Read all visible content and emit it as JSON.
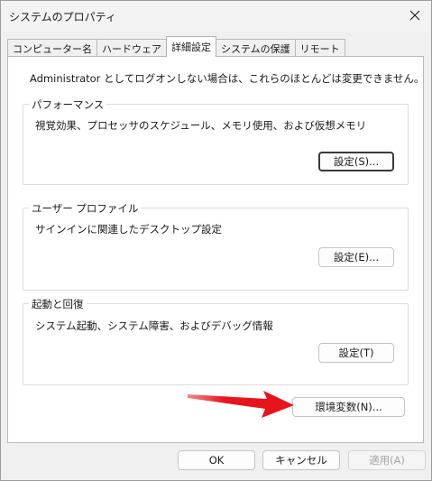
{
  "window": {
    "title": "システムのプロパティ",
    "close_glyph": "✕"
  },
  "tabs": [
    {
      "label": "コンピューター名"
    },
    {
      "label": "ハードウェア"
    },
    {
      "label": "詳細設定",
      "active": true
    },
    {
      "label": "システムの保護"
    },
    {
      "label": "リモート"
    }
  ],
  "panel": {
    "intro": "Administrator としてログオンしない場合は、これらのほとんどは変更できません。",
    "performance": {
      "legend": "パフォーマンス",
      "description": "視覚効果、プロセッサのスケジュール、メモリ使用、および仮想メモリ",
      "button": "設定(S)..."
    },
    "user_profile": {
      "legend": "ユーザー プロファイル",
      "description": "サインインに関連したデスクトップ設定",
      "button": "設定(E)..."
    },
    "startup": {
      "legend": "起動と回復",
      "description": "システム起動、システム障害、およびデバッグ情報",
      "button": "設定(T)"
    },
    "env_button": "環境変数(N)..."
  },
  "footer": {
    "ok": "OK",
    "cancel": "キャンセル",
    "apply": "適用(A)"
  },
  "colors": {
    "annotation_arrow": "#e8141c",
    "panel_bg": "#ffffff",
    "window_bg": "#f0f0f0"
  }
}
